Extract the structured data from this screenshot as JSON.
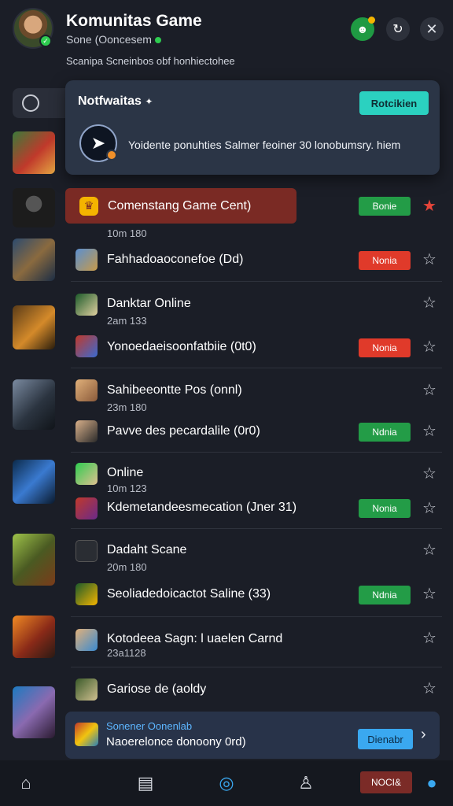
{
  "header": {
    "title": "Komunitas Game",
    "subtitle": "Sone (Ooncesem",
    "description": "Scanipa Scneinbos obf honhiectohee"
  },
  "notification": {
    "title": "Notfwaitas",
    "action_label": "Rotcikien",
    "message": "Yoidente ponuhties Salmer feoiner 30 lonobumsry. hiem"
  },
  "highlight": {
    "label": "Comenstang Game Cent)"
  },
  "rows": [
    {
      "sub": "10m 180"
    },
    {
      "title": "Fahhadoaoconefoe (Dd)",
      "badge": "Nonia"
    },
    {
      "title": "Danktar Online",
      "sub": "2am 133"
    },
    {
      "title": "Yonoedaeisoonfatbiie (0t0)",
      "badge": "Nonia"
    },
    {
      "title": "Sahibeeontte Pos (onnl)",
      "sub": "23m 180"
    },
    {
      "title": "Pavve des pecardalile (0r0)",
      "badge": "Ndnia"
    },
    {
      "title": "Online",
      "sub": "10m 123"
    },
    {
      "title": "Kdemetandeesmecation (Jner 31)",
      "badge": "Nonia"
    },
    {
      "title": "Dadaht Scane",
      "sub": "20m 180"
    },
    {
      "title": "Seoliadedoicactot Saline (33)",
      "badge": "Ndnia"
    },
    {
      "title": "Kotodeea Sagn: l uaelen Carnd",
      "sub": "23a1128"
    },
    {
      "title": "Gariose de (aoldy"
    }
  ],
  "highlight_badge": "Bonie",
  "promo": {
    "label": "Sonener Oonenlab",
    "text": "Naoerelonce donoony 0rd)",
    "button": "Dienabr"
  },
  "nav": {
    "pill": "NOCI&"
  },
  "colors": {
    "background": "#1b1e27",
    "accent_teal": "#2bd1c0",
    "badge_red": "#e03a2a",
    "badge_green": "#239c47",
    "highlight_row": "#7a2a24",
    "nav_active": "#3aa8f0"
  }
}
